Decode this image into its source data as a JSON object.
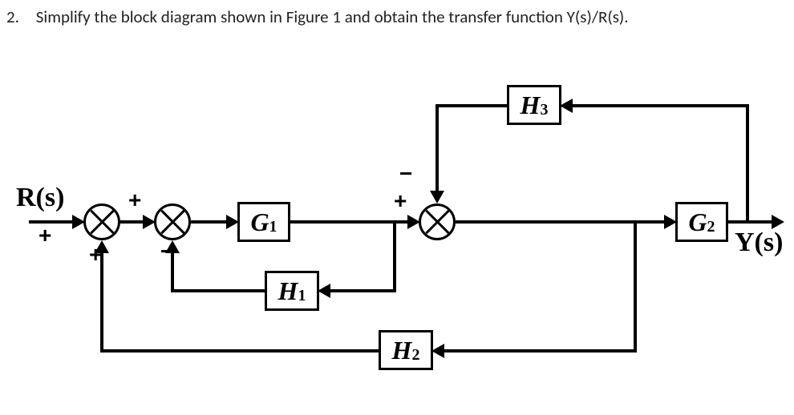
{
  "question": {
    "number": "2.",
    "text": "Simplify the block diagram shown in Figure 1 and obtain the transfer function Y(s)/R(s)."
  },
  "diagram": {
    "input_label": "R(s)",
    "output_label": "Y(s)",
    "blocks": {
      "G1": {
        "base": "G",
        "sub": "1"
      },
      "G2": {
        "base": "G",
        "sub": "2"
      },
      "H1": {
        "base": "H",
        "sub": "1"
      },
      "H2": {
        "base": "H",
        "sub": "2"
      },
      "H3": {
        "base": "H",
        "sub": "3"
      }
    },
    "summing_points": {
      "S1": {
        "top": "+",
        "bottom": "+"
      },
      "S2": {
        "top": "+",
        "bottom": "−"
      },
      "S3": {
        "top_right": "+",
        "top_left": "−"
      }
    },
    "transfer_function_to_obtain": "Y(s)/R(s)"
  }
}
